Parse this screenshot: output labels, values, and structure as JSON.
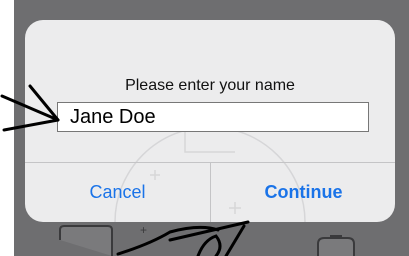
{
  "dialog": {
    "title": "Please enter your name",
    "name_field": {
      "value": "Jane Doe"
    },
    "cancel_label": "Cancel",
    "continue_label": "Continue"
  },
  "colors": {
    "backdrop": "#6e6e70",
    "dialog_bg": "#ececed",
    "button_blue": "#1a73e8",
    "annotation_ink": "#000000"
  }
}
